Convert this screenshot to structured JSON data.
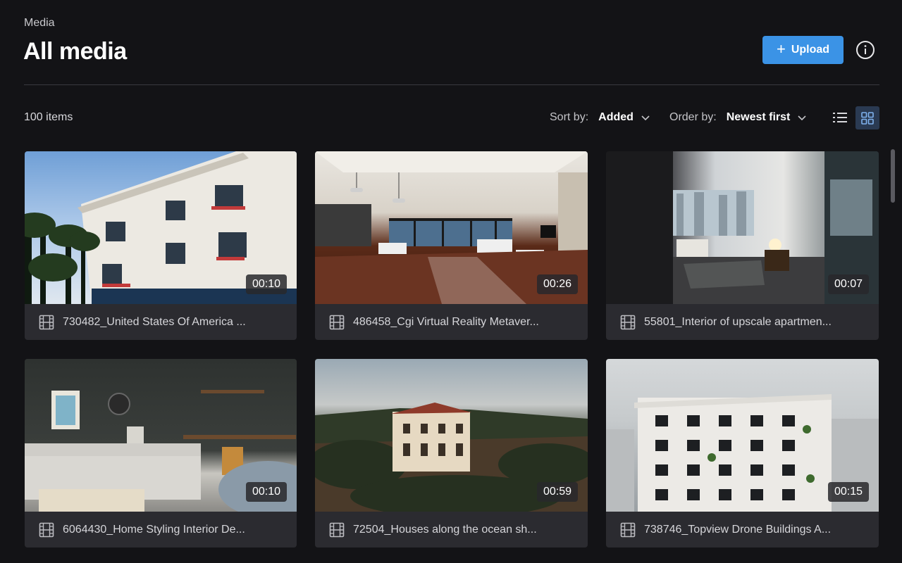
{
  "header": {
    "breadcrumb": "Media",
    "title": "All media",
    "upload_label": "Upload"
  },
  "toolbar": {
    "item_count": "100 items",
    "sort_label": "Sort by:",
    "sort_value": "Added",
    "order_label": "Order by:",
    "order_value": "Newest first"
  },
  "colors": {
    "background": "#131316",
    "accent": "#3b93e6",
    "card": "#2b2b30"
  },
  "media": [
    {
      "title": "730482_United States Of America ...",
      "duration": "00:10",
      "icon": "film-icon"
    },
    {
      "title": "486458_Cgi Virtual Reality Metaver...",
      "duration": "00:26",
      "icon": "film-icon"
    },
    {
      "title": "55801_Interior of upscale apartmen...",
      "duration": "00:07",
      "icon": "film-icon"
    },
    {
      "title": "6064430_Home Styling Interior De...",
      "duration": "00:10",
      "icon": "film-icon"
    },
    {
      "title": "72504_Houses along the ocean sh...",
      "duration": "00:59",
      "icon": "film-icon"
    },
    {
      "title": "738746_Topview Drone Buildings A...",
      "duration": "00:15",
      "icon": "film-icon"
    }
  ]
}
